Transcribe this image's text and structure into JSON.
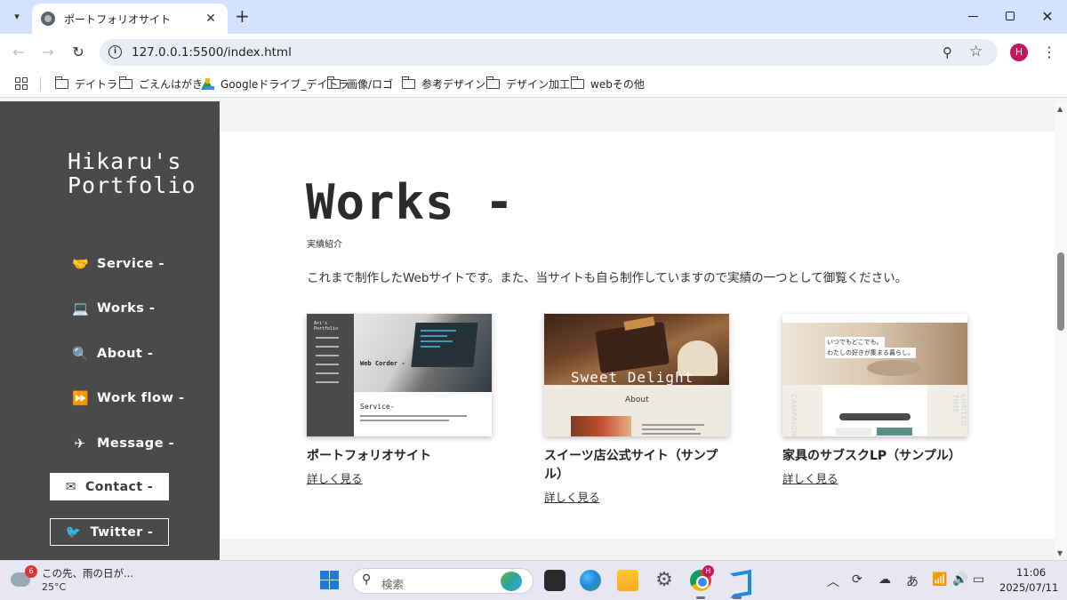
{
  "browser": {
    "tab_title": "ポートフォリオサイト",
    "tab_close": "✕",
    "new_tab": "+",
    "url": "127.0.0.1:5500/index.html",
    "profile_initial": "H",
    "bookmarks": [
      "デイトラ",
      "ごえんはがき",
      "Googleドライブ_デイトラ",
      "画像/ロゴ",
      "参考デザイン",
      "デザイン加工",
      "webその他"
    ]
  },
  "sidebar": {
    "title_line1": "Hikaru's",
    "title_line2": "Portfolio",
    "nav": [
      {
        "label": "Service -",
        "icon": "handshake-icon"
      },
      {
        "label": "Works -",
        "icon": "laptop-icon"
      },
      {
        "label": "About -",
        "icon": "search-icon"
      },
      {
        "label": "Work flow -",
        "icon": "fast-forward-icon"
      },
      {
        "label": "Message -",
        "icon": "paper-plane-icon"
      }
    ],
    "contact_label": "Contact -",
    "twitter_label": "Twitter -"
  },
  "works": {
    "title": "Works -",
    "subtitle": "実績紹介",
    "description": "これまで制作したWebサイトです。また、当サイトも自ら制作していますので実績の一つとして御覧ください。",
    "cards": [
      {
        "title": "ポートフォリオサイト",
        "link": "詳しく見る",
        "thumb_texts": [
          "Ari's",
          "Portfolio",
          "Web Corder -",
          "Service-"
        ]
      },
      {
        "title": "スイーツ店公式サイト（サンプル）",
        "link": "詳しく見る",
        "thumb_texts": [
          "Sweet Delight",
          "About"
        ]
      },
      {
        "title": "家具のサブスクLP（サンプル）",
        "link": "詳しく見る",
        "thumb_texts": [
          "いつでもどこでも。",
          "わたしの好きが集まる暮らし。",
          "CAMPAIGN",
          "LIMITED TIME"
        ]
      }
    ]
  },
  "taskbar": {
    "weather_badge": "6",
    "weather_text": "この先、雨の日が...",
    "weather_temp": "25°C",
    "search_placeholder": "検索",
    "chrome_badge": "H",
    "ime": "あ",
    "time": "11:06",
    "date": "2025/07/11"
  }
}
